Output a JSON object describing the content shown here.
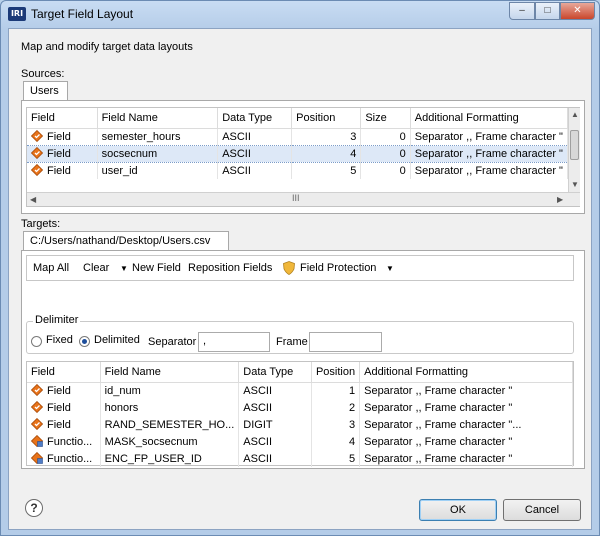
{
  "window": {
    "app_icon_text": "IRI",
    "title": "Target Field Layout",
    "minimize": "–",
    "maximize": "□",
    "close": "✕"
  },
  "subtitle": "Map and modify target data layouts",
  "sources": {
    "label": "Sources:",
    "tab": "Users",
    "columns": [
      "Field",
      "Field Name",
      "Data Type",
      "Position",
      "Size",
      "Additional Formatting"
    ],
    "rows": [
      {
        "field": "Field",
        "name": "semester_hours",
        "type": "ASCII",
        "position": "3",
        "size": "0",
        "formatting": "Separator ,, Frame character \""
      },
      {
        "field": "Field",
        "name": "socsecnum",
        "type": "ASCII",
        "position": "4",
        "size": "0",
        "formatting": "Separator ,, Frame character \""
      },
      {
        "field": "Field",
        "name": "user_id",
        "type": "ASCII",
        "position": "5",
        "size": "0",
        "formatting": "Separator ,, Frame character \""
      }
    ],
    "hscroll_grip": "III"
  },
  "targets": {
    "label": "Targets:",
    "tab": "C:/Users/nathand/Desktop/Users.csv",
    "toolbar": {
      "map_all": "Map All",
      "clear": "Clear",
      "new_field": "New Field",
      "reposition": "Reposition Fields",
      "protection": "Field Protection"
    },
    "delimiter": {
      "label": "Delimiter",
      "fixed": "Fixed",
      "delimited": "Delimited",
      "separator_label": "Separator",
      "separator_value": ",",
      "frame_label": "Frame",
      "frame_value": ""
    },
    "columns": [
      "Field",
      "Field Name",
      "Data Type",
      "Position",
      "Additional Formatting"
    ],
    "rows": [
      {
        "field": "Field",
        "name": "id_num",
        "type": "ASCII",
        "position": "1",
        "formatting": "Separator ,, Frame character \"",
        "icon": "field-icon"
      },
      {
        "field": "Field",
        "name": "honors",
        "type": "ASCII",
        "position": "2",
        "formatting": "Separator ,, Frame character \"",
        "icon": "field-icon"
      },
      {
        "field": "Field",
        "name": "RAND_SEMESTER_HO...",
        "type": "DIGIT",
        "position": "3",
        "formatting": "Separator ,, Frame character \"...",
        "icon": "field-icon"
      },
      {
        "field": "Functio...",
        "name": "MASK_socsecnum",
        "type": "ASCII",
        "position": "4",
        "formatting": "Separator ,, Frame character \"",
        "icon": "function-icon"
      },
      {
        "field": "Functio...",
        "name": "ENC_FP_USER_ID",
        "type": "ASCII",
        "position": "5",
        "formatting": "Separator ,, Frame character \"",
        "icon": "function-icon"
      }
    ]
  },
  "buttons": {
    "help": "?",
    "ok": "OK",
    "cancel": "Cancel"
  },
  "colors": {
    "field_icon": "#e8731a",
    "shield_icon": "#f0b73a",
    "selection": "#dde8f7"
  }
}
